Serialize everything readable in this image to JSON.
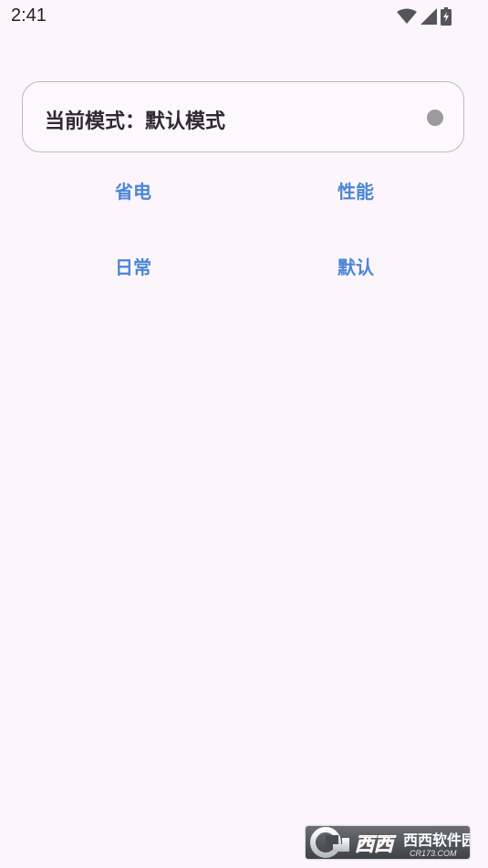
{
  "status_bar": {
    "time": "2:41",
    "icons": [
      "wifi-icon",
      "cell-signal-icon",
      "battery-charging-icon"
    ]
  },
  "mode_card": {
    "text": "当前模式：默认模式",
    "indicator_color": "#9b9b9b"
  },
  "modes": {
    "saving": "省电",
    "performance": "性能",
    "daily": "日常",
    "default": "默认"
  },
  "watermark": {
    "text": "西西软件园",
    "subtext": "CR173.COM"
  },
  "colors": {
    "background": "#fcf5fc",
    "accent": "#4a86d6"
  }
}
